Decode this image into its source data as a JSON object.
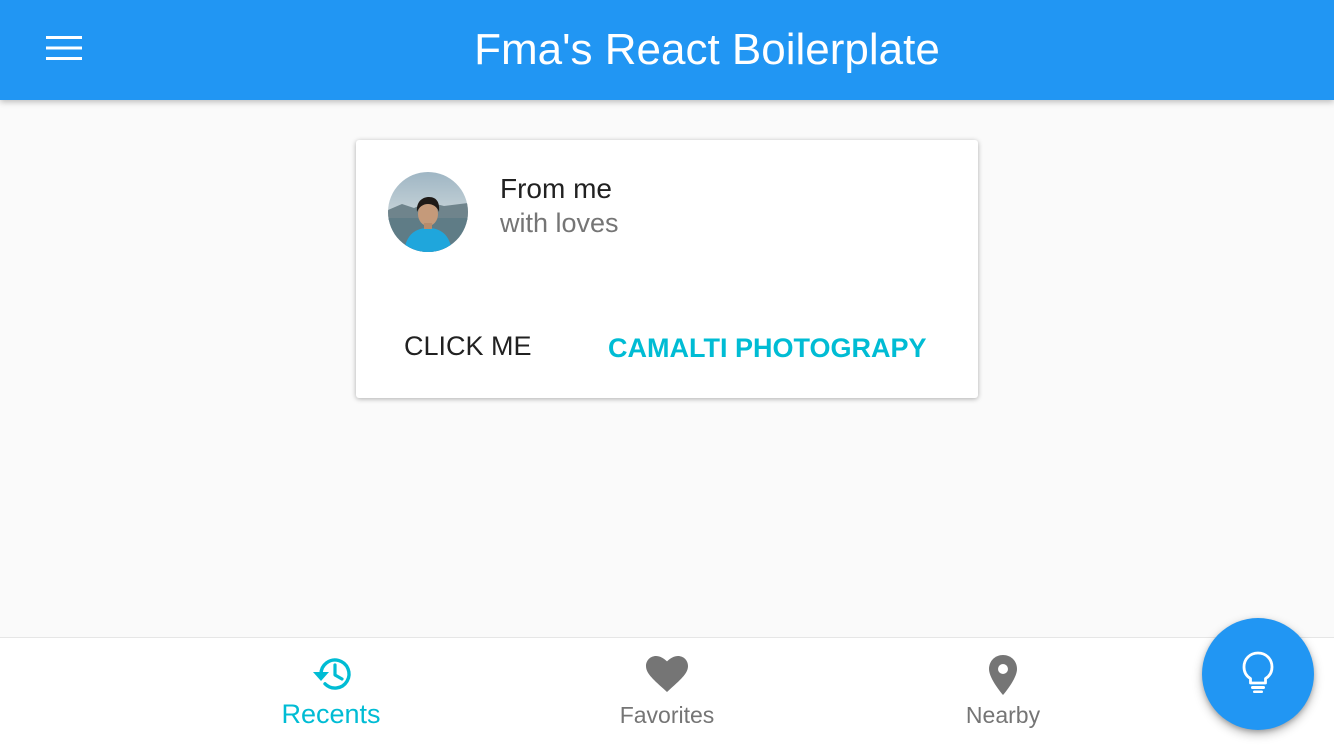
{
  "app_bar": {
    "title": "Fma's React Boilerplate",
    "menu_icon": "hamburger-menu-icon",
    "background": "#2196f3"
  },
  "card": {
    "avatar_icon": "user-avatar-photo",
    "title": "From me",
    "subtitle": "with loves",
    "actions": [
      {
        "label": "CLICK ME",
        "color": "#212121"
      },
      {
        "label": "CAMALTI PHOTOGRAPY",
        "color": "#00bcd4"
      }
    ]
  },
  "bottom_nav": {
    "items": [
      {
        "label": "Recents",
        "icon": "history-icon",
        "active": true
      },
      {
        "label": "Favorites",
        "icon": "heart-icon",
        "active": false
      },
      {
        "label": "Nearby",
        "icon": "location-pin-icon",
        "active": false
      }
    ]
  },
  "fab": {
    "icon": "lightbulb-icon",
    "background": "#2196f3"
  },
  "colors": {
    "primary": "#2196f3",
    "accent": "#00bcd4",
    "inactive": "#757575"
  }
}
